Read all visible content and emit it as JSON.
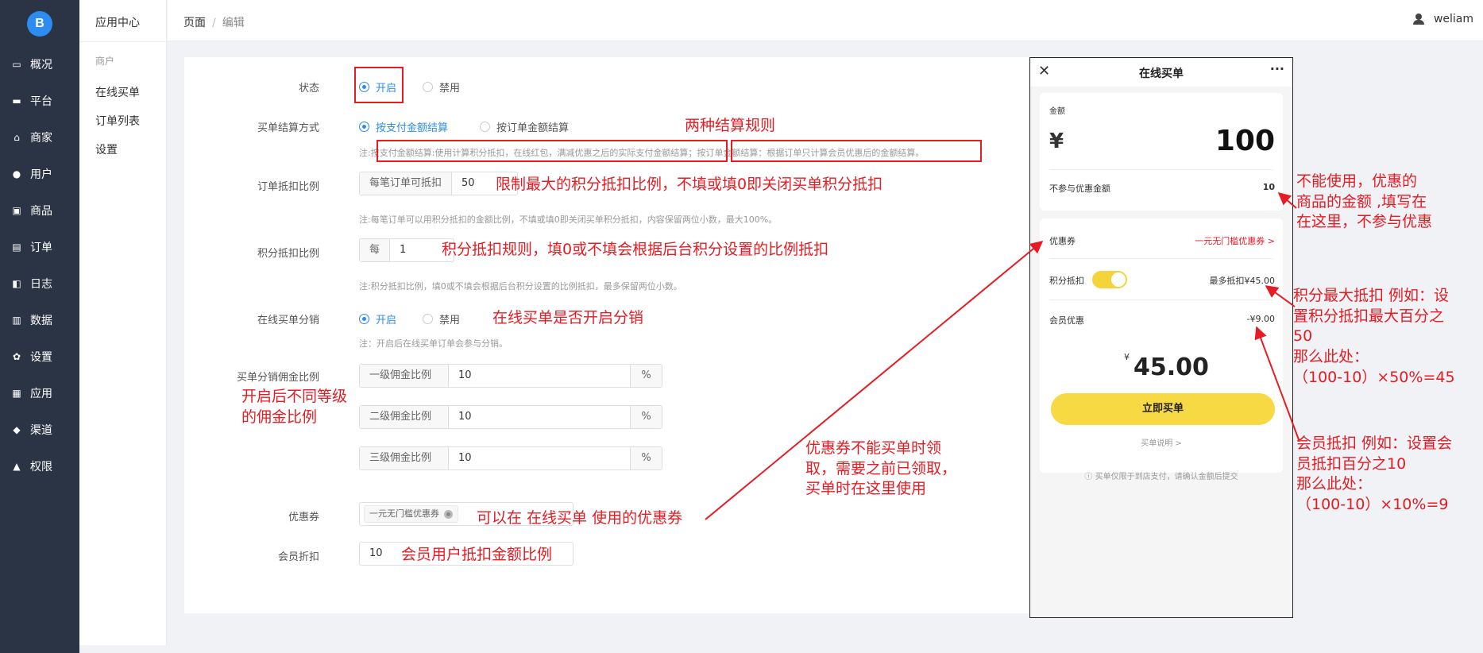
{
  "brand": {
    "logo_text": "B",
    "accent": "#2d8cf0",
    "annotation_color": "#e51c23"
  },
  "nav": {
    "items": [
      {
        "label": "概况",
        "icon": "overview-icon",
        "glyph": "▭"
      },
      {
        "label": "平台",
        "icon": "platform-icon",
        "glyph": "▬"
      },
      {
        "label": "商家",
        "icon": "store-icon",
        "glyph": "⌂"
      },
      {
        "label": "用户",
        "icon": "user-icon",
        "glyph": "●"
      },
      {
        "label": "商品",
        "icon": "product-icon",
        "glyph": "▣"
      },
      {
        "label": "订单",
        "icon": "order-icon",
        "glyph": "▤"
      },
      {
        "label": "日志",
        "icon": "log-icon",
        "glyph": "◧"
      },
      {
        "label": "数据",
        "icon": "data-icon",
        "glyph": "▥"
      },
      {
        "label": "设置",
        "icon": "settings-icon",
        "glyph": "✿"
      },
      {
        "label": "应用",
        "icon": "apps-icon",
        "glyph": "▦"
      },
      {
        "label": "渠道",
        "icon": "channel-icon",
        "glyph": "◆"
      },
      {
        "label": "权限",
        "icon": "permission-icon",
        "glyph": "▲"
      }
    ]
  },
  "submenu": {
    "title": "应用中心",
    "group": "商户",
    "links": [
      "在线买单",
      "订单列表",
      "设置"
    ]
  },
  "header": {
    "crumb_root": "页面",
    "crumb_sep": "/",
    "crumb_current": "编辑",
    "username": "weliam"
  },
  "form": {
    "status": {
      "label": "状态",
      "on": "开启",
      "off": "禁用"
    },
    "settle": {
      "label": "买单结算方式",
      "opt1": "按支付金额结算",
      "opt2": "按订单金额结算",
      "note_prefix": "注:",
      "note1": "按支付金额结算:使用计算积分抵扣，在线红包，满减优惠之后的实际支付金额结算；",
      "note2": "按订单金额结算：根据订单只计算会员优惠后的金额结算。"
    },
    "order_ratio": {
      "label": "订单抵扣比例",
      "prefix": "每笔订单可抵扣",
      "value": "50",
      "note": "注:每笔订单可以用积分抵扣的金额比例，不填或填0即关闭买单积分抵扣，内容保留两位小数，最大100%。"
    },
    "points_ratio": {
      "label": "积分抵扣比例",
      "prefix": "每",
      "value": "1",
      "note": "注:积分抵扣比例，填0或不填会根据后台积分设置的比例抵扣，最多保留两位小数。"
    },
    "distribution": {
      "label": "在线买单分销",
      "on": "开启",
      "off": "禁用",
      "note": "注：开启后在线买单订单会参与分销。"
    },
    "commission": {
      "label": "买单分销佣金比例",
      "rows": [
        {
          "prefix": "一级佣金比例",
          "value": "10",
          "suffix": "%"
        },
        {
          "prefix": "二级佣金比例",
          "value": "10",
          "suffix": "%"
        },
        {
          "prefix": "三级佣金比例",
          "value": "10",
          "suffix": "%"
        }
      ]
    },
    "coupon": {
      "label": "优惠券",
      "tag": "一元无门槛优惠券"
    },
    "member": {
      "label": "会员折扣",
      "value": "10"
    }
  },
  "annotations": {
    "two_rules": "两种结算规则",
    "max_ratio": "限制最大的积分抵扣比例，不填或填0即关闭买单积分抵扣",
    "points_rule": "积分抵扣规则，填0或不填会根据后台积分设置的比例抵扣",
    "distribution": "在线买单是否开启分销",
    "levels_1": "开启后不同等级",
    "levels_2": "的佣金比例",
    "coupon_use": "可以在 在线买单 使用的优惠券",
    "member_ratio": "会员用户抵扣金额比例",
    "coupon_note_1": "优惠券不能买单时领",
    "coupon_note_2": "取，需要之前已领取，",
    "coupon_note_3": "买单时在这里使用",
    "exclude_1": "不能使用，优惠的",
    "exclude_2": "商品的金额 ,填写在",
    "exclude_3": "在这里，不参与优惠",
    "points_max_1": "积分最大抵扣 例如：设",
    "points_max_2": "置积分抵扣最大百分之",
    "points_max_3": "50",
    "points_max_4": "那么此处：",
    "points_max_5": "（100-10）×50%=45",
    "member_ex_1": "会员抵扣 例如：设置会",
    "member_ex_2": "员抵扣百分之10",
    "member_ex_3": "那么此处：",
    "member_ex_4": "（100-10）×10%=9"
  },
  "phone": {
    "close": "✕",
    "title": "在线买单",
    "more": "···",
    "amount_label": "金额",
    "currency": "¥",
    "amount": "100",
    "exclude_label": "不参与优惠金额",
    "exclude_value": "10",
    "coupon_label": "优惠券",
    "coupon_value": "一元无门槛优惠券 >",
    "points_label": "积分抵扣",
    "points_value": "最多抵扣¥45.00",
    "member_label": "会员优惠",
    "member_value": "-¥9.00",
    "total_currency": "¥",
    "total": "45.00",
    "buy": "立即买单",
    "explain": "买单说明 >",
    "footnote": "ⓘ 买单仅限于到店支付，请确认金额后提交"
  }
}
